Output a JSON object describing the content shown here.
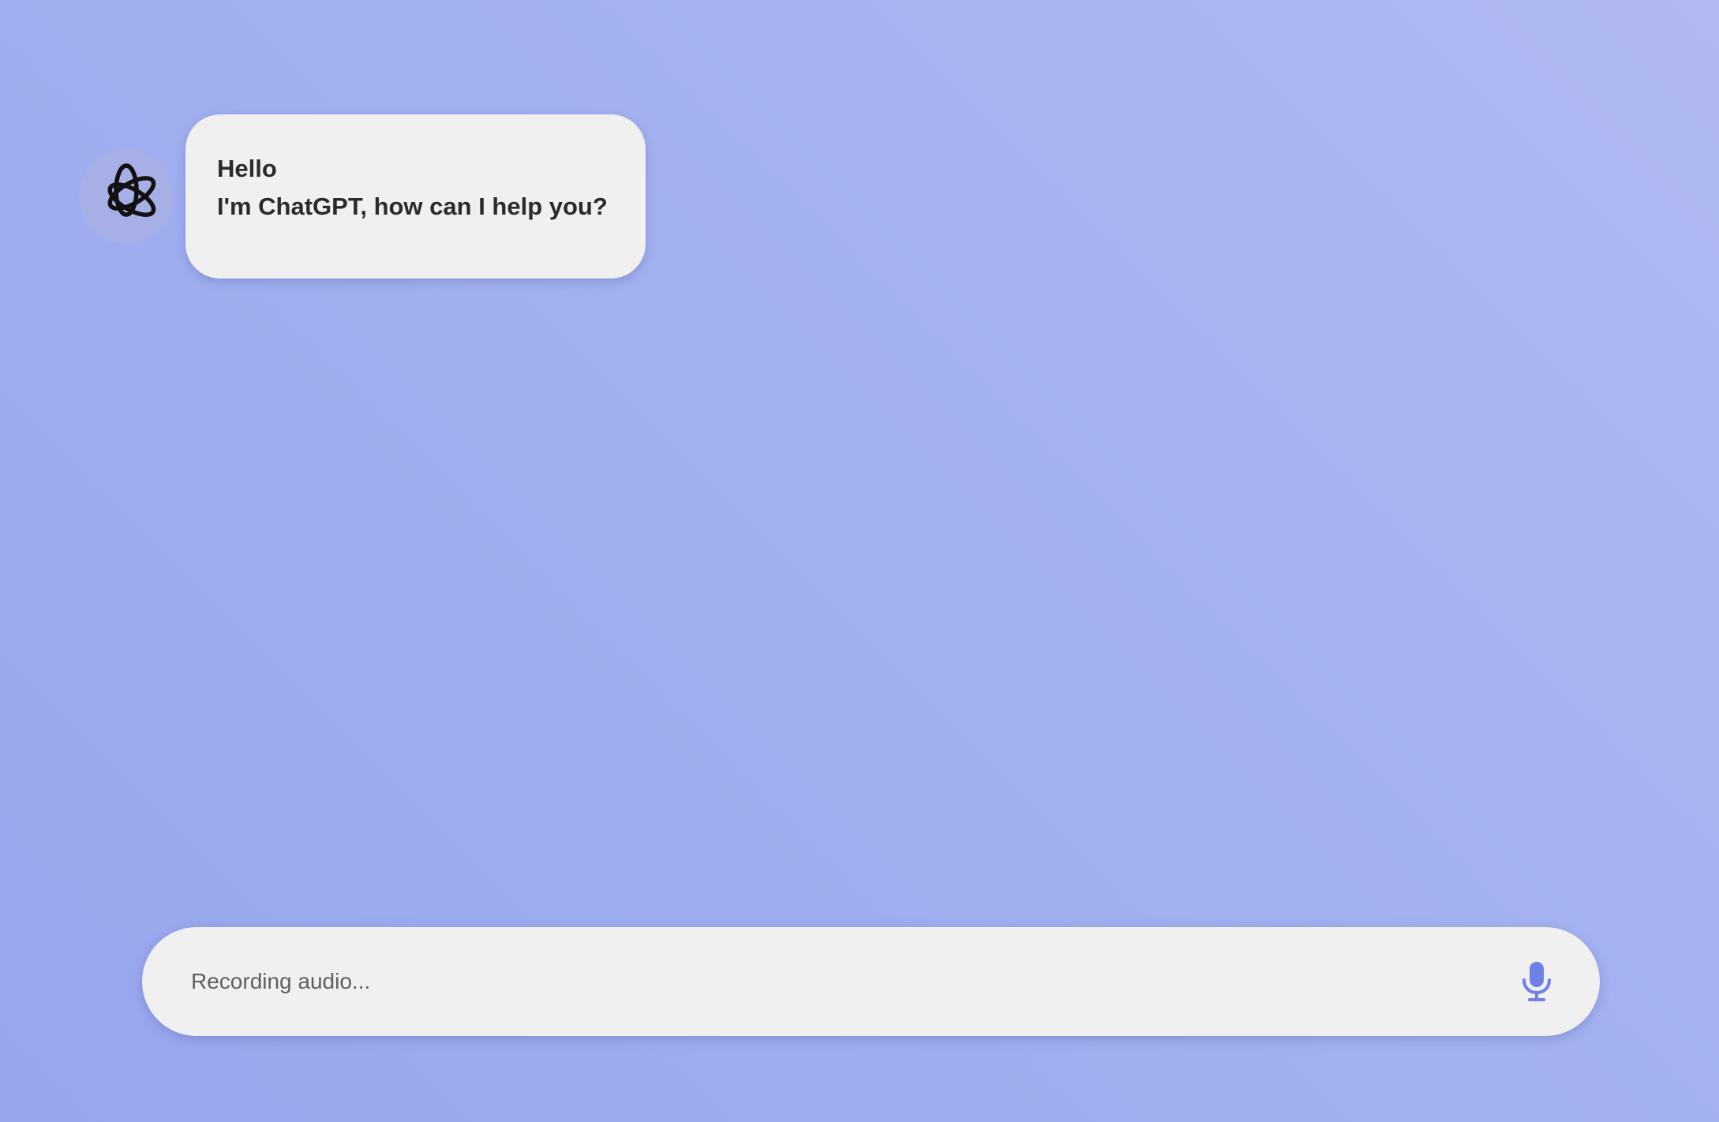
{
  "chat": {
    "assistant_avatar": {
      "icon": "openai-logo-icon"
    },
    "messages": [
      {
        "sender": "assistant",
        "lines": [
          "Hello",
          "I'm ChatGPT, how can I help you?"
        ]
      }
    ]
  },
  "composer": {
    "placeholder": "Recording audio...",
    "mic_icon": "microphone-icon",
    "accent_color": "#6f80e6"
  },
  "colors": {
    "background_start": "#b0b9f1",
    "background_end": "#97a6ee",
    "bubble": "#f0f0f0",
    "text": "#2b2b2b"
  }
}
